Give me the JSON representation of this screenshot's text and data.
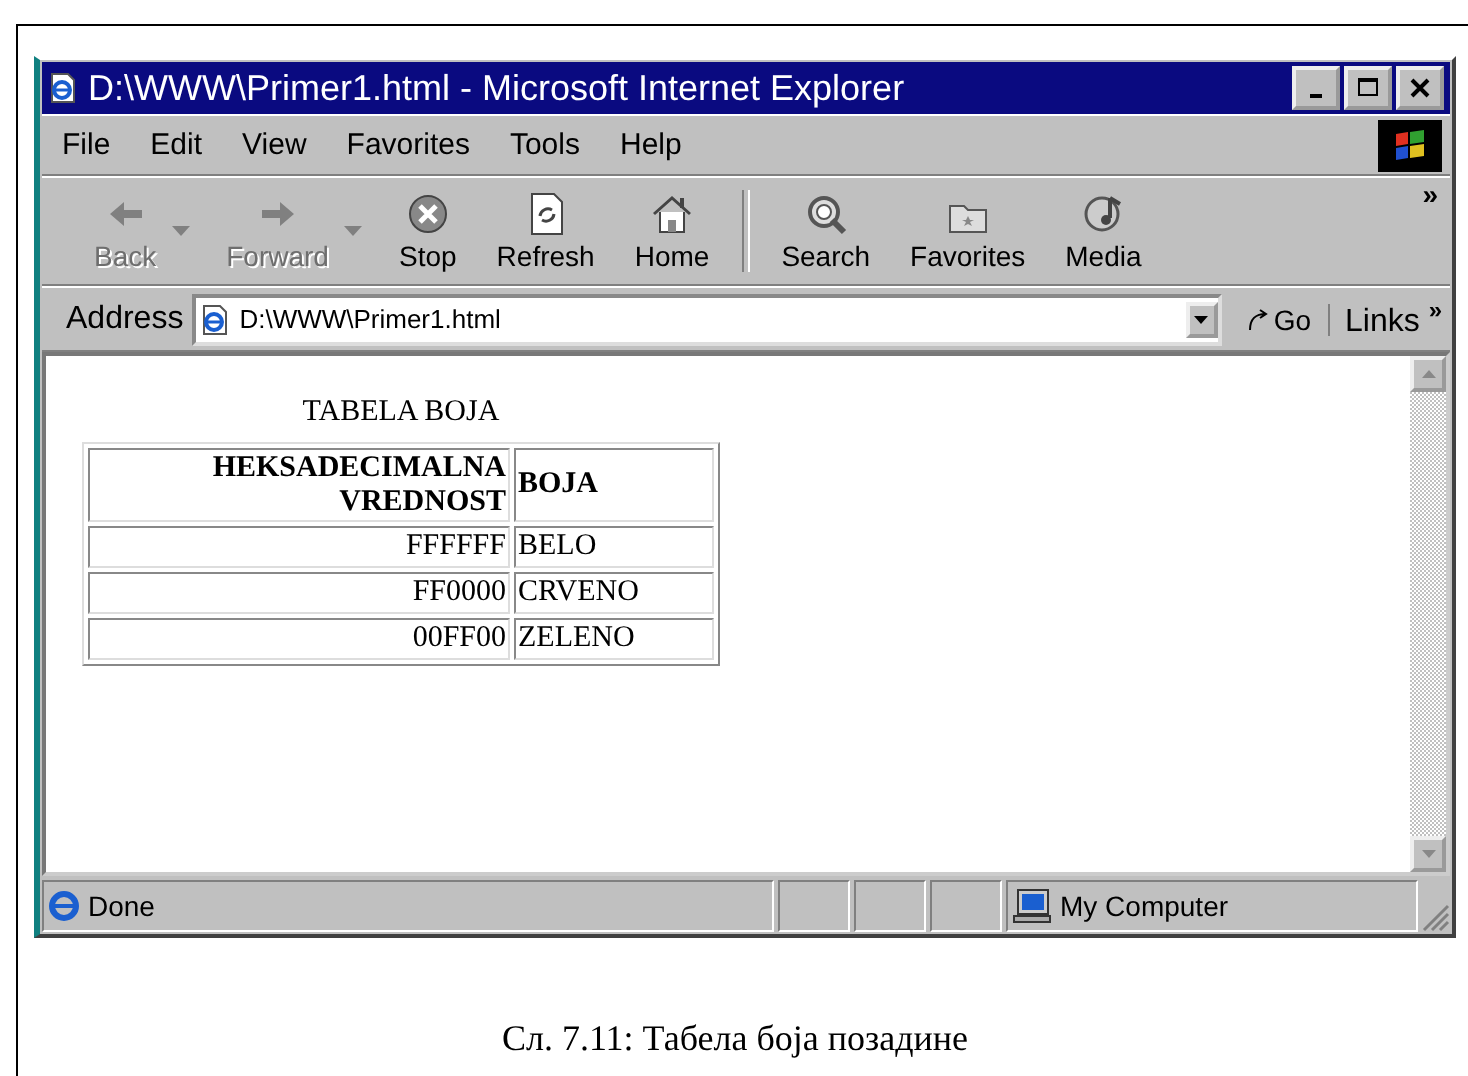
{
  "window": {
    "title": "D:\\WWW\\Primer1.html - Microsoft Internet Explorer"
  },
  "menu": [
    "File",
    "Edit",
    "View",
    "Favorites",
    "Tools",
    "Help"
  ],
  "toolbar": {
    "groups": [
      [
        {
          "kind": "back",
          "label": "Back",
          "disabled": true,
          "dropdown": true
        },
        {
          "kind": "forward",
          "label": "Forward",
          "disabled": true,
          "dropdown": true
        },
        {
          "kind": "stop",
          "label": "Stop",
          "disabled": false,
          "dropdown": false
        },
        {
          "kind": "refresh",
          "label": "Refresh",
          "disabled": false,
          "dropdown": false
        },
        {
          "kind": "home",
          "label": "Home",
          "disabled": false,
          "dropdown": false
        }
      ],
      [
        {
          "kind": "search",
          "label": "Search",
          "disabled": false,
          "dropdown": false
        },
        {
          "kind": "favorites",
          "label": "Favorites",
          "disabled": false,
          "dropdown": false
        },
        {
          "kind": "media",
          "label": "Media",
          "disabled": false,
          "dropdown": false
        }
      ]
    ],
    "overflow": "»"
  },
  "address": {
    "label": "Address",
    "value": "D:\\WWW\\Primer1.html",
    "go": "Go",
    "links": "Links",
    "overflow": "»"
  },
  "page": {
    "heading": "TABELA BOJA",
    "columns": [
      "HEKSADECIMALNA VREDNOST",
      "BOJA"
    ],
    "rows": [
      [
        "FFFFFF",
        "BELO"
      ],
      [
        "FF0000",
        "CRVENO"
      ],
      [
        "00FF00",
        "ZELENO"
      ]
    ]
  },
  "status": {
    "text": "Done",
    "zone": "My Computer"
  },
  "caption": "Сл. 7.11: Табела боја позадине"
}
